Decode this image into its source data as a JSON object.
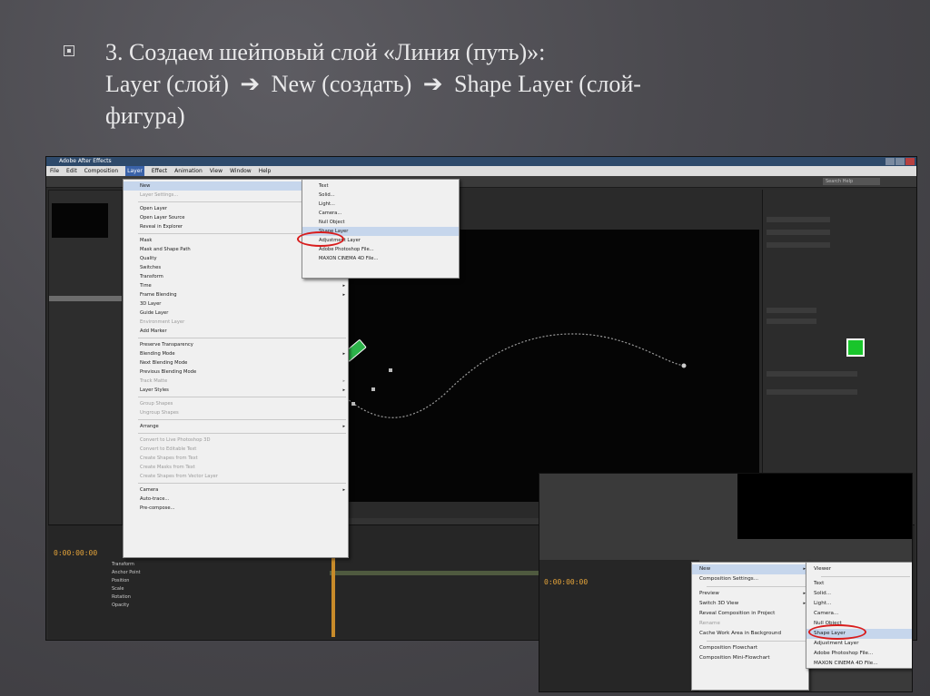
{
  "slide": {
    "line1": "3. Создаем шейповый слой «Линия (путь)»:",
    "line2_a": "Layer (слой)",
    "arrow": "➔",
    "line2_b": "New (создать)",
    "line2_c": "Shape Layer (слой-",
    "line3": "фигура)"
  },
  "app": {
    "title": "Adobe After Effects",
    "menus": [
      "File",
      "Edit",
      "Composition",
      "Layer",
      "Effect",
      "Animation",
      "View",
      "Window",
      "Help"
    ],
    "search_placeholder": "Search Help"
  },
  "layer_menu": {
    "items": [
      {
        "label": "New",
        "sub": true,
        "hl": true
      },
      {
        "label": "Layer Settings...",
        "dis": true
      },
      {
        "sep": true
      },
      {
        "label": "Open Layer"
      },
      {
        "label": "Open Layer Source"
      },
      {
        "label": "Reveal in Explorer"
      },
      {
        "sep": true
      },
      {
        "label": "Mask",
        "sub": true
      },
      {
        "label": "Mask and Shape Path",
        "sub": true
      },
      {
        "label": "Quality",
        "sub": true
      },
      {
        "label": "Switches",
        "sub": true
      },
      {
        "label": "Transform",
        "sub": true
      },
      {
        "label": "Time",
        "sub": true
      },
      {
        "label": "Frame Blending",
        "sub": true
      },
      {
        "label": "3D Layer"
      },
      {
        "label": "Guide Layer"
      },
      {
        "label": "Environment Layer",
        "dis": true
      },
      {
        "label": "Add Marker"
      },
      {
        "sep": true
      },
      {
        "label": "Preserve Transparency"
      },
      {
        "label": "Blending Mode",
        "sub": true
      },
      {
        "label": "Next Blending Mode"
      },
      {
        "label": "Previous Blending Mode"
      },
      {
        "label": "Track Matte",
        "dis": true,
        "sub": true
      },
      {
        "label": "Layer Styles",
        "sub": true
      },
      {
        "sep": true
      },
      {
        "label": "Group Shapes",
        "dis": true
      },
      {
        "label": "Ungroup Shapes",
        "dis": true
      },
      {
        "sep": true
      },
      {
        "label": "Arrange",
        "sub": true
      },
      {
        "sep": true
      },
      {
        "label": "Convert to Live Photoshop 3D",
        "dis": true
      },
      {
        "label": "Convert to Editable Text",
        "dis": true
      },
      {
        "label": "Create Shapes from Text",
        "dis": true
      },
      {
        "label": "Create Masks from Text",
        "dis": true
      },
      {
        "label": "Create Shapes from Vector Layer",
        "dis": true
      },
      {
        "sep": true
      },
      {
        "label": "Camera",
        "sub": true
      },
      {
        "label": "Auto-trace..."
      },
      {
        "label": "Pre-compose..."
      }
    ]
  },
  "new_menu": {
    "items": [
      {
        "label": "Text"
      },
      {
        "label": "Solid..."
      },
      {
        "label": "Light..."
      },
      {
        "label": "Camera..."
      },
      {
        "label": "Null Object"
      },
      {
        "label": "Shape Layer",
        "hl": true
      },
      {
        "label": "Adjustment Layer"
      },
      {
        "label": "Adobe Photoshop File..."
      },
      {
        "label": "MAXON CINEMA 4D File..."
      }
    ]
  },
  "timeline": {
    "time": "0:00:00:00",
    "rows": [
      {
        "name": "Transform",
        "val": ""
      },
      {
        "name": "Anchor Point",
        "val": ""
      },
      {
        "name": "Position",
        "val": ""
      },
      {
        "name": "Scale",
        "val": ""
      },
      {
        "name": "Rotation",
        "val": ""
      },
      {
        "name": "Opacity",
        "val": ""
      }
    ]
  },
  "inset": {
    "time": "0:00:00:00",
    "menu1": [
      {
        "label": "New",
        "sub": true,
        "hl": true
      },
      {
        "label": "Composition Settings..."
      },
      {
        "sep": true
      },
      {
        "label": "Preview",
        "sub": true
      },
      {
        "label": "Switch 3D View",
        "sub": true
      },
      {
        "label": "Reveal Composition in Project"
      },
      {
        "label": "Rename",
        "dis": true
      },
      {
        "label": "Cache Work Area in Background"
      },
      {
        "sep": true
      },
      {
        "label": "Composition Flowchart"
      },
      {
        "label": "Composition Mini-Flowchart"
      }
    ],
    "menu2": [
      {
        "label": "Viewer"
      },
      {
        "sep": true
      },
      {
        "label": "Text"
      },
      {
        "label": "Solid..."
      },
      {
        "label": "Light..."
      },
      {
        "label": "Camera..."
      },
      {
        "label": "Null Object"
      },
      {
        "label": "Shape Layer",
        "hl": true
      },
      {
        "label": "Adjustment Layer"
      },
      {
        "label": "Adobe Photoshop File..."
      },
      {
        "label": "MAXON CINEMA 4D File..."
      }
    ]
  }
}
